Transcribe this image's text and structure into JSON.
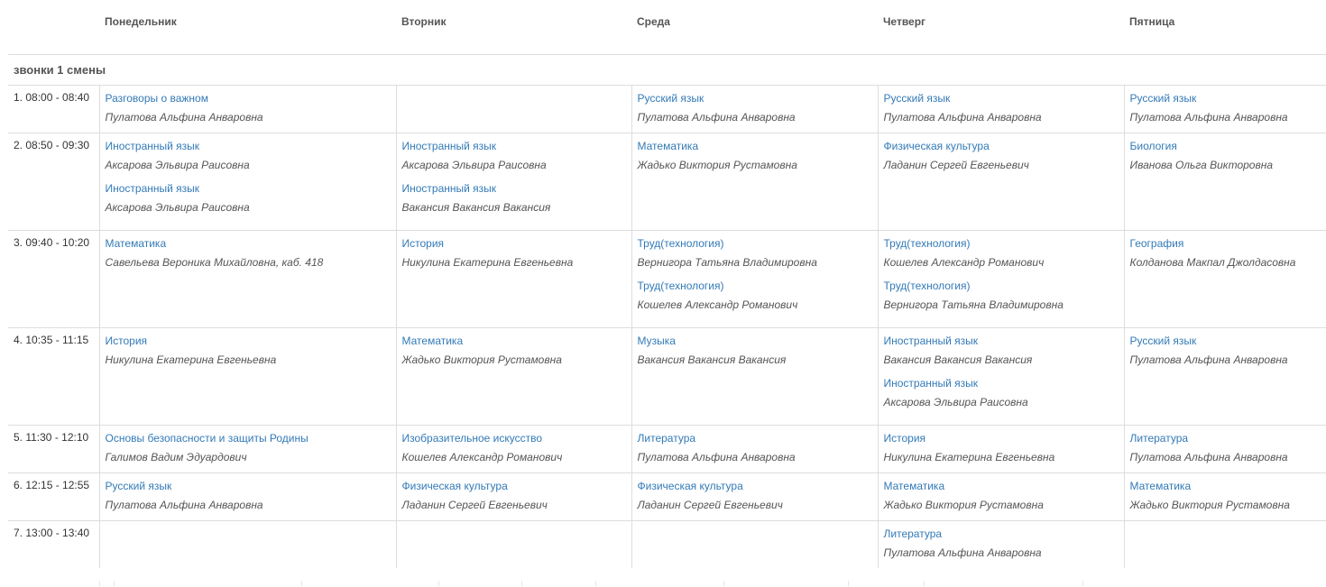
{
  "header": {
    "days": [
      "Понедельник",
      "Вторник",
      "Среда",
      "Четверг",
      "Пятница"
    ]
  },
  "shift_label": "звонки 1 смены",
  "rows": [
    {
      "time": "1. 08:00 - 08:40",
      "cells": [
        [
          {
            "subject": "Разговоры о важном",
            "teacher": "Пулатова Альфина Анваровна"
          }
        ],
        [],
        [
          {
            "subject": "Русский язык",
            "teacher": "Пулатова Альфина Анваровна"
          }
        ],
        [
          {
            "subject": "Русский язык",
            "teacher": "Пулатова Альфина Анваровна"
          }
        ],
        [
          {
            "subject": "Русский язык",
            "teacher": "Пулатова Альфина Анваровна"
          }
        ]
      ]
    },
    {
      "time": "2. 08:50 - 09:30",
      "cells": [
        [
          {
            "subject": "Иностранный язык",
            "teacher": "Аксарова Эльвира Раисовна"
          },
          {
            "subject": "Иностранный язык",
            "teacher": "Аксарова Эльвира Раисовна"
          }
        ],
        [
          {
            "subject": "Иностранный язык",
            "teacher": "Аксарова Эльвира Раисовна"
          },
          {
            "subject": "Иностранный язык",
            "teacher": "Вакансия Вакансия Вакансия"
          }
        ],
        [
          {
            "subject": "Математика",
            "teacher": "Жадько Виктория Рустамовна"
          }
        ],
        [
          {
            "subject": "Физическая культура",
            "teacher": "Ладанин Сергей Евгеньевич"
          }
        ],
        [
          {
            "subject": "Биология",
            "teacher": "Иванова Ольга Викторовна"
          }
        ]
      ]
    },
    {
      "time": "3. 09:40 - 10:20",
      "cells": [
        [
          {
            "subject": "Математика",
            "teacher": "Савельева Вероника Михайловна, каб. 418"
          }
        ],
        [
          {
            "subject": "История",
            "teacher": "Никулина Екатерина Евгеньевна"
          }
        ],
        [
          {
            "subject": "Труд(технология)",
            "teacher": "Вернигора Татьяна Владимировна"
          },
          {
            "subject": "Труд(технология)",
            "teacher": "Кошелев Александр Романович"
          }
        ],
        [
          {
            "subject": "Труд(технология)",
            "teacher": "Кошелев Александр Романович"
          },
          {
            "subject": "Труд(технология)",
            "teacher": "Вернигора Татьяна Владимировна"
          }
        ],
        [
          {
            "subject": "География",
            "teacher": "Колданова Макпал Джолдасовна"
          }
        ]
      ]
    },
    {
      "time": "4. 10:35 - 11:15",
      "cells": [
        [
          {
            "subject": "История",
            "teacher": "Никулина Екатерина Евгеньевна"
          }
        ],
        [
          {
            "subject": "Математика",
            "teacher": "Жадько Виктория Рустамовна"
          }
        ],
        [
          {
            "subject": "Музыка",
            "teacher": "Вакансия Вакансия Вакансия"
          }
        ],
        [
          {
            "subject": "Иностранный язык",
            "teacher": "Вакансия Вакансия Вакансия"
          },
          {
            "subject": "Иностранный язык",
            "teacher": "Аксарова Эльвира Раисовна"
          }
        ],
        [
          {
            "subject": "Русский язык",
            "teacher": "Пулатова Альфина Анваровна"
          }
        ]
      ]
    },
    {
      "time": "5. 11:30 - 12:10",
      "cells": [
        [
          {
            "subject": "Основы безопасности и защиты Родины",
            "teacher": "Галимов Вадим Эдуардович"
          }
        ],
        [
          {
            "subject": "Изобразительное искусство",
            "teacher": "Кошелев Александр Романович"
          }
        ],
        [
          {
            "subject": "Литература",
            "teacher": "Пулатова Альфина Анваровна"
          }
        ],
        [
          {
            "subject": "История",
            "teacher": "Никулина Екатерина Евгеньевна"
          }
        ],
        [
          {
            "subject": "Литература",
            "teacher": "Пулатова Альфина Анваровна"
          }
        ]
      ]
    },
    {
      "time": "6. 12:15 - 12:55",
      "cells": [
        [
          {
            "subject": "Русский язык",
            "teacher": "Пулатова Альфина Анваровна"
          }
        ],
        [
          {
            "subject": "Физическая культура",
            "teacher": "Ладанин Сергей Евгеньевич"
          }
        ],
        [
          {
            "subject": "Физическая культура",
            "teacher": "Ладанин Сергей Евгеньевич"
          }
        ],
        [
          {
            "subject": "Математика",
            "teacher": "Жадько Виктория Рустамовна"
          }
        ],
        [
          {
            "subject": "Математика",
            "teacher": "Жадько Виктория Рустамовна"
          }
        ]
      ]
    },
    {
      "time": "7. 13:00 - 13:40",
      "cells": [
        [],
        [],
        [],
        [
          {
            "subject": "Литература",
            "teacher": "Пулатова Альфина Анваровна"
          }
        ],
        []
      ]
    }
  ]
}
